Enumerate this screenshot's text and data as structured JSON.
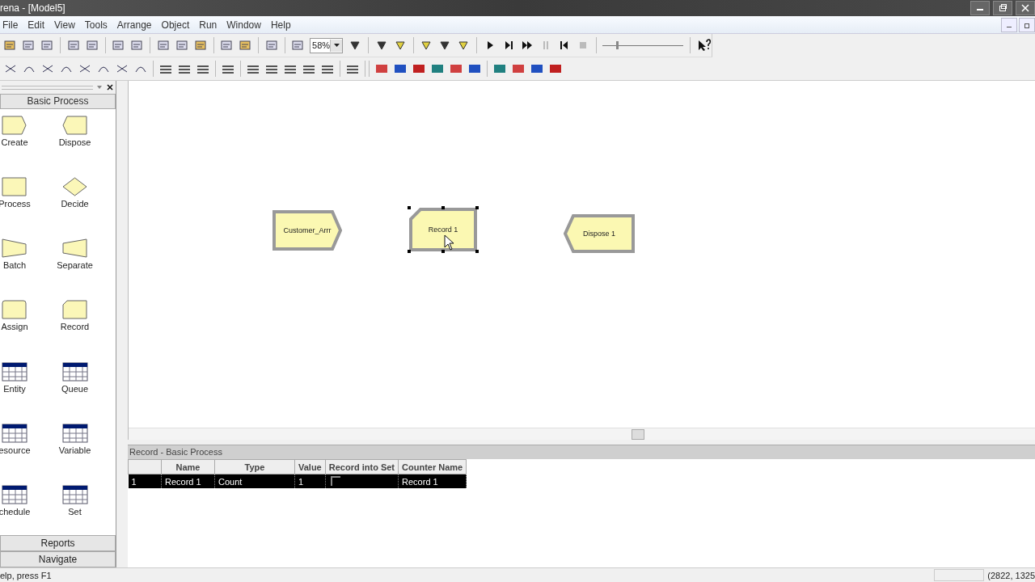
{
  "window": {
    "title": "rena - [Model5]"
  },
  "menu": [
    "File",
    "Edit",
    "View",
    "Tools",
    "Arrange",
    "Object",
    "Run",
    "Window",
    "Help"
  ],
  "toolbar": {
    "zoom": "58%",
    "speed": {
      "level": 0.17
    }
  },
  "palette": {
    "title": "Basic Process",
    "items": [
      {
        "label": "Create",
        "kind": "create"
      },
      {
        "label": "Dispose",
        "kind": "dispose"
      },
      {
        "label": "Process",
        "kind": "process"
      },
      {
        "label": "Decide",
        "kind": "decide"
      },
      {
        "label": "Batch",
        "kind": "batch"
      },
      {
        "label": "Separate",
        "kind": "separate"
      },
      {
        "label": "Assign",
        "kind": "assign"
      },
      {
        "label": "Record",
        "kind": "record"
      },
      {
        "label": "Entity",
        "kind": "data"
      },
      {
        "label": "Queue",
        "kind": "data"
      },
      {
        "label": "esource",
        "kind": "data"
      },
      {
        "label": "Variable",
        "kind": "data"
      },
      {
        "label": "chedule",
        "kind": "data"
      },
      {
        "label": "Set",
        "kind": "data"
      }
    ],
    "panels": [
      "Reports",
      "Navigate"
    ]
  },
  "canvas": {
    "modules": [
      {
        "label": "Customer_Arrr",
        "kind": "create",
        "selected": false
      },
      {
        "label": "Record 1",
        "kind": "record",
        "selected": true
      },
      {
        "label": "Dispose 1",
        "kind": "dispose",
        "selected": false
      }
    ]
  },
  "spreadsheet": {
    "title": "Record - Basic Process",
    "columns": [
      "Name",
      "Type",
      "Value",
      "Record into Set",
      "Counter Name"
    ],
    "rows": [
      {
        "index": "1",
        "name": "Record 1",
        "type": "Count",
        "value": "1",
        "record_into_set": false,
        "counter_name": "Record 1",
        "selected": true
      }
    ]
  },
  "status_bar": {
    "help": "elp, press F1",
    "coordinates": "(2822, 1325"
  }
}
